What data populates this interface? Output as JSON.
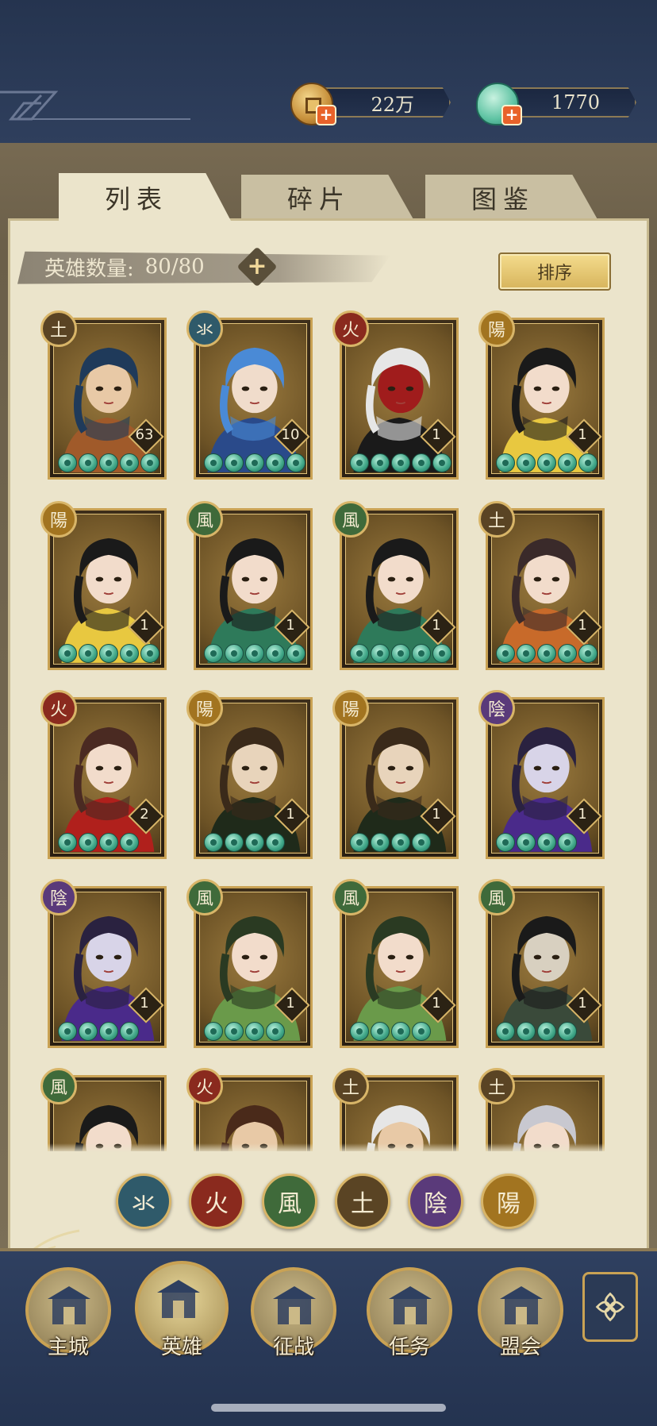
{
  "currencies": [
    {
      "name": "coin",
      "value": "22万",
      "icon": "coin-icon"
    },
    {
      "name": "jade",
      "value": "1770",
      "icon": "jade-shell-icon"
    }
  ],
  "tabs": [
    {
      "label": "列表",
      "active": true
    },
    {
      "label": "碎片",
      "active": false
    },
    {
      "label": "图鉴",
      "active": false
    }
  ],
  "hero_count": {
    "label": "英雄数量:",
    "value": "80/80"
  },
  "sort_label": "排序",
  "elements": {
    "water": {
      "glyph": "氺",
      "color": "#2f5a6a"
    },
    "fire": {
      "glyph": "火",
      "color": "#8a2a1e"
    },
    "wind": {
      "glyph": "風",
      "color": "#3f6a3a"
    },
    "earth": {
      "glyph": "土",
      "color": "#5a4424"
    },
    "yin": {
      "glyph": "陰",
      "color": "#5a3a7a"
    },
    "yang": {
      "glyph": "陽",
      "color": "#a27420"
    }
  },
  "heroes": [
    {
      "element": "earth",
      "level": "63",
      "stars": 5,
      "palette": [
        "#1f3a5a",
        "#a05a2a",
        "#e8c9a6"
      ]
    },
    {
      "element": "water",
      "level": "10",
      "stars": 5,
      "palette": [
        "#4a8ad6",
        "#2a4a8a",
        "#f0dccb"
      ]
    },
    {
      "element": "fire",
      "level": "1",
      "stars": 5,
      "palette": [
        "#e6e6e6",
        "#1a1a1a",
        "#a01c1c"
      ]
    },
    {
      "element": "yang",
      "level": "1",
      "stars": 5,
      "palette": [
        "#1a1a1a",
        "#e8c840",
        "#f2dccb"
      ]
    },
    {
      "element": "yang",
      "level": "1",
      "stars": 5,
      "palette": [
        "#1a1a1a",
        "#e8c840",
        "#f2dccb"
      ]
    },
    {
      "element": "wind",
      "level": "1",
      "stars": 5,
      "palette": [
        "#1a1a1a",
        "#2e7a5a",
        "#f2dccb"
      ]
    },
    {
      "element": "wind",
      "level": "1",
      "stars": 5,
      "palette": [
        "#1a1a1a",
        "#2e7a5a",
        "#f2dccb"
      ]
    },
    {
      "element": "earth",
      "level": "1",
      "stars": 5,
      "palette": [
        "#3a2a2a",
        "#c86a2a",
        "#f2dccb"
      ]
    },
    {
      "element": "fire",
      "level": "2",
      "stars": 4,
      "palette": [
        "#4a2a22",
        "#b0201c",
        "#f2dccb"
      ]
    },
    {
      "element": "yang",
      "level": "1",
      "stars": 4,
      "palette": [
        "#3a2a1a",
        "#1f2a1a",
        "#e8d4bb"
      ]
    },
    {
      "element": "yang",
      "level": "1",
      "stars": 4,
      "palette": [
        "#3a2a1a",
        "#1f2a1a",
        "#e8d4bb"
      ]
    },
    {
      "element": "yin",
      "level": "1",
      "stars": 4,
      "palette": [
        "#2a2240",
        "#4a2a8a",
        "#d8d4e8"
      ]
    },
    {
      "element": "yin",
      "level": "1",
      "stars": 4,
      "palette": [
        "#2a2240",
        "#4a2a8a",
        "#d8d4e8"
      ]
    },
    {
      "element": "wind",
      "level": "1",
      "stars": 4,
      "palette": [
        "#2a3a22",
        "#6a9a4a",
        "#f2dccb"
      ]
    },
    {
      "element": "wind",
      "level": "1",
      "stars": 4,
      "palette": [
        "#2a3a22",
        "#6a9a4a",
        "#f2dccb"
      ]
    },
    {
      "element": "wind",
      "level": "1",
      "stars": 4,
      "palette": [
        "#1a1a1a",
        "#3a4a3a",
        "#d8d0c0"
      ]
    },
    {
      "element": "wind",
      "level": "",
      "stars": 0,
      "palette": [
        "#1a1a1a",
        "#2e4a3a",
        "#f2dccb"
      ]
    },
    {
      "element": "fire",
      "level": "",
      "stars": 0,
      "palette": [
        "#4a2a1a",
        "#a01c1c",
        "#e8c9a6"
      ]
    },
    {
      "element": "earth",
      "level": "",
      "stars": 0,
      "palette": [
        "#e6e6e6",
        "#6a4a2a",
        "#e8c9a6"
      ]
    },
    {
      "element": "earth",
      "level": "",
      "stars": 0,
      "palette": [
        "#c8c8d0",
        "#6a6a7a",
        "#f2dccb"
      ]
    }
  ],
  "filters": [
    "water",
    "fire",
    "wind",
    "earth",
    "yin",
    "yang"
  ],
  "nav": [
    {
      "label": "主城",
      "icon": "city-gate-icon"
    },
    {
      "label": "英雄",
      "icon": "hero-portrait-icon"
    },
    {
      "label": "征战",
      "icon": "campaign-scroll-icon"
    },
    {
      "label": "任务",
      "icon": "quest-scroll-icon"
    },
    {
      "label": "盟会",
      "icon": "alliance-pavilion-icon"
    }
  ],
  "nav_extra_icon": "flower-menu-icon"
}
